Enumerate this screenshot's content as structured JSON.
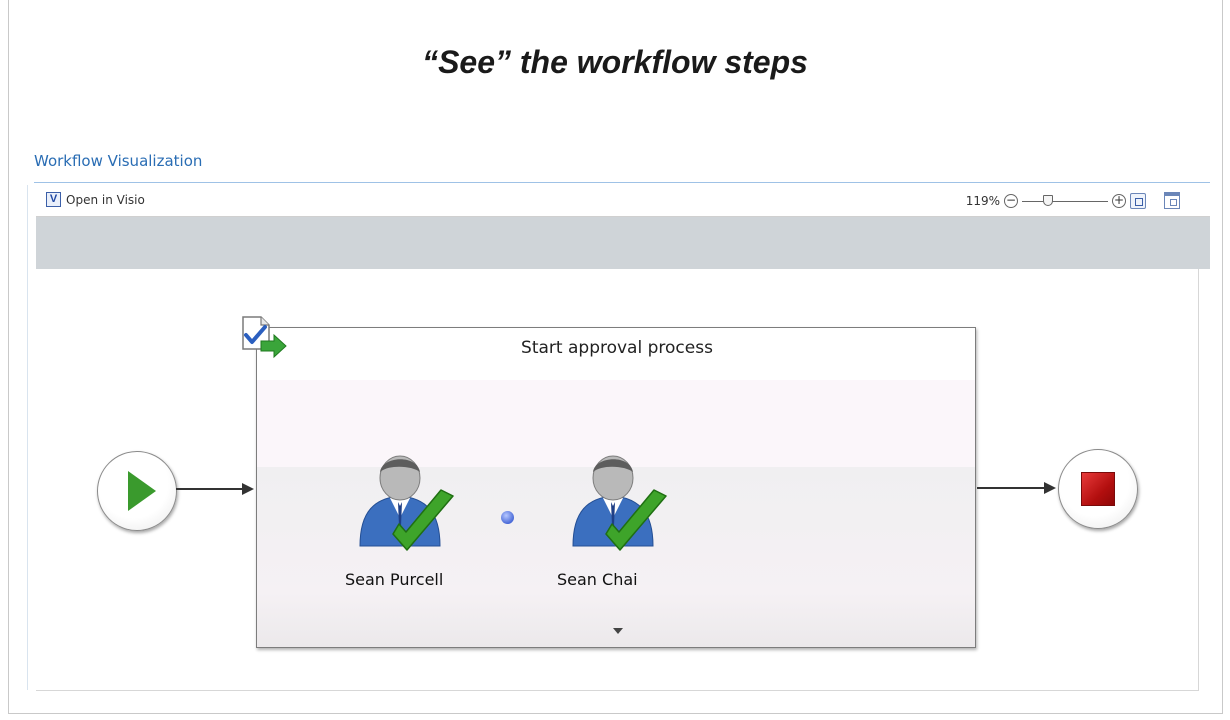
{
  "slide": {
    "title": "“See” the workflow steps"
  },
  "section": {
    "title": "Workflow Visualization"
  },
  "toolbar": {
    "open_visio_label": "Open in Visio",
    "visio_icon_glyph": "V",
    "zoom_value": "119%",
    "zoom_slider_level": 0.3
  },
  "workflow": {
    "stage_title": "Start approval process",
    "approvers": [
      {
        "name": "Sean Purcell",
        "status": "approved",
        "icon": "approver-check-icon"
      },
      {
        "name": "Sean Chai",
        "status": "approved",
        "icon": "approver-check-icon"
      }
    ]
  },
  "colors": {
    "accent_blue": "#2a6db4",
    "start_green": "#3a9a2d",
    "end_red": "#c81414",
    "check_green": "#3ea42a"
  }
}
